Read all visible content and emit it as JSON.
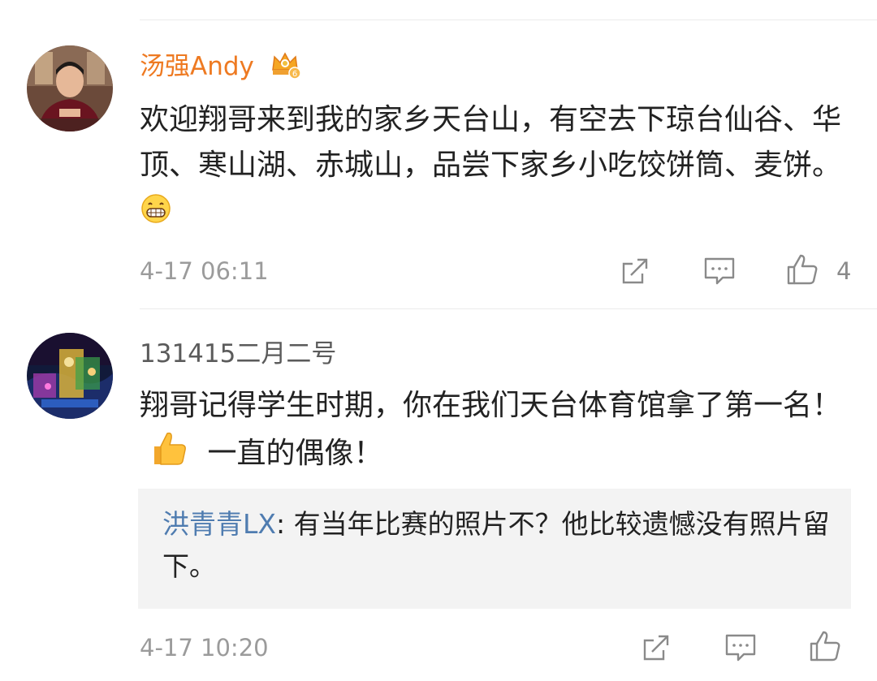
{
  "comments": [
    {
      "username": "汤强Andy",
      "badge_icon": "vip-crown-badge-icon",
      "text": "欢迎翔哥来到我的家乡天台山，有空去下琼台仙谷、华顶、寒山湖、赤城山，品尝下家乡小吃饺饼筒、麦饼。",
      "emoji": "grinning-face-icon",
      "timestamp": "4-17 06:11",
      "likes": "4"
    },
    {
      "username": "131415二月二号",
      "text_part1": "翔哥记得学生时期，你在我们天台体育馆拿了第一名！",
      "emoji": "thumbs-up-icon",
      "text_part2": "一直的偶像！",
      "reply_author": "洪青青LX",
      "reply_separator": ": ",
      "reply_text": "有当年比赛的照片不？他比较遗憾没有照片留下。",
      "timestamp": "4-17 10:20"
    }
  ],
  "colors": {
    "vip_name": "#ee7a22",
    "reply_author": "#4f7cb0",
    "meta": "#9b9b9b"
  },
  "icons": [
    "share-icon",
    "comment-icon",
    "like-icon"
  ]
}
